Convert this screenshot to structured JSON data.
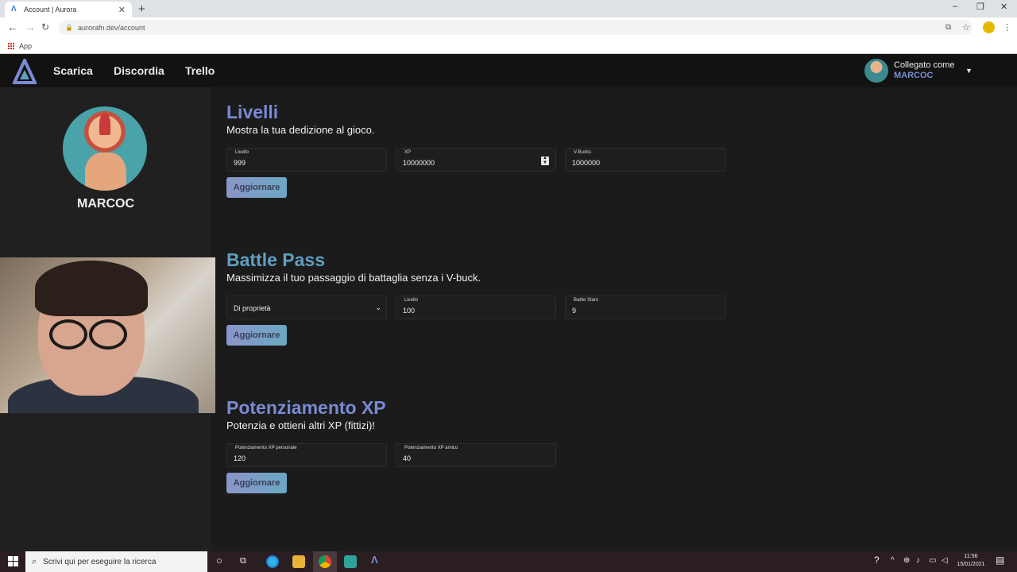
{
  "browser": {
    "tab_title": "Account | Aurora",
    "url": "aurorafn.dev/account",
    "bookmarks_label": "App"
  },
  "header": {
    "nav": [
      "Scarica",
      "Discordia",
      "Trello"
    ],
    "logged_as_label": "Collegato come",
    "username": "MARCOC"
  },
  "profile": {
    "name": "MARCOC"
  },
  "sections": {
    "levels": {
      "title": "Livelli",
      "subtitle": "Mostra la tua dedizione al gioco.",
      "fields": [
        {
          "label": "Livello",
          "value": "999"
        },
        {
          "label": "XP",
          "value": "10000000"
        },
        {
          "label": "V-Bucks",
          "value": "1000000"
        }
      ],
      "button": "Aggiornare"
    },
    "battlepass": {
      "title": "Battle Pass",
      "subtitle": "Massimizza il tuo passaggio di battaglia senza i V-buck.",
      "select_value": "Di proprietà",
      "fields": [
        {
          "label": "Livello",
          "value": "100"
        },
        {
          "label": "Battle Stars",
          "value": "9"
        }
      ],
      "button": "Aggiornare"
    },
    "xpboost": {
      "title": "Potenziamento XP",
      "subtitle": "Potenzia e ottieni altri XP (fittizi)!",
      "fields": [
        {
          "label": "Potenziamento XP personale",
          "value": "120"
        },
        {
          "label": "Potenziamento XP amico",
          "value": "40"
        }
      ],
      "button": "Aggiornare"
    }
  },
  "taskbar": {
    "search_placeholder": "Scrivi qui per eseguire la ricerca",
    "time": "11:56",
    "date": "15/01/2021"
  },
  "colors": {
    "accent_purple": "#7a8ad3",
    "accent_teal": "#5f9fc0",
    "background": "#1b1b1b"
  }
}
